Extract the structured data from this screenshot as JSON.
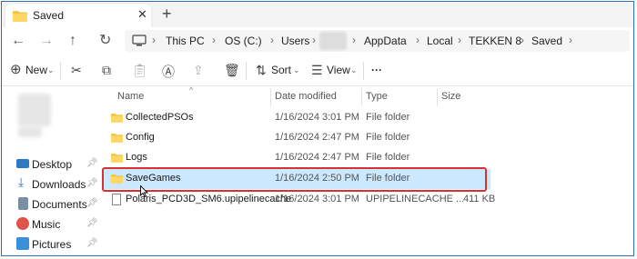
{
  "window": {
    "tab_title": "Saved",
    "tab_close": "✕",
    "new_tab": "+"
  },
  "nav": {
    "back": "←",
    "forward": "→",
    "up": "↑",
    "refresh": "↻",
    "breadcrumbs": [
      "This PC",
      "OS (C:)",
      "Users",
      "AppData",
      "Local",
      "TEKKEN 8",
      "Saved"
    ]
  },
  "toolbar": {
    "new_label": "New",
    "sort_label": "Sort",
    "view_label": "View",
    "more_label": "···"
  },
  "sidebar": {
    "items": [
      {
        "label": "Desktop",
        "icon": "desktop-icon",
        "color": "#2f78c4"
      },
      {
        "label": "Downloads",
        "icon": "download-icon",
        "color": "#2f78c4"
      },
      {
        "label": "Documents",
        "icon": "document-icon",
        "color": "#7a8fa6"
      },
      {
        "label": "Music",
        "icon": "music-icon",
        "color": "#e0524a"
      },
      {
        "label": "Pictures",
        "icon": "picture-icon",
        "color": "#3a8fd8"
      }
    ]
  },
  "columns": [
    "Name",
    "Date modified",
    "Type",
    "Size"
  ],
  "files": [
    {
      "name": "CollectedPSOs",
      "date": "1/16/2024 3:01 PM",
      "type": "File folder",
      "size": "",
      "kind": "folder"
    },
    {
      "name": "Config",
      "date": "1/16/2024 2:47 PM",
      "type": "File folder",
      "size": "",
      "kind": "folder"
    },
    {
      "name": "Logs",
      "date": "1/16/2024 2:47 PM",
      "type": "File folder",
      "size": "",
      "kind": "folder"
    },
    {
      "name": "SaveGames",
      "date": "1/16/2024 2:50 PM",
      "type": "File folder",
      "size": "",
      "kind": "folder",
      "selected": true
    },
    {
      "name": "Polaris_PCD3D_SM6.upipelinecache",
      "date": "1/16/2024 3:01 PM",
      "type": "UPIPELINECACHE ...",
      "size": "411 KB",
      "kind": "file"
    }
  ],
  "colors": {
    "selection": "#cce8ff",
    "highlight_border": "#d93030",
    "folder": "#f4c542"
  }
}
